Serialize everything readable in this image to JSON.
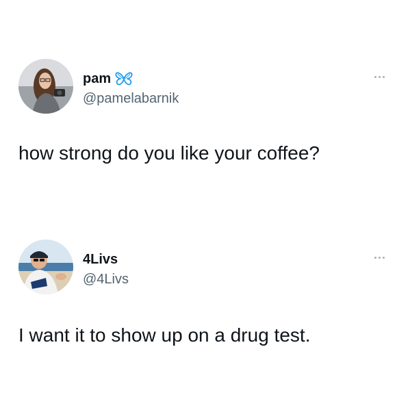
{
  "tweets": [
    {
      "display_name": "pam",
      "name_emoji": "butterfly-icon",
      "handle": "@pamelabarnik",
      "text": "how strong do you like your coffee?",
      "avatar": "profile-photo"
    },
    {
      "display_name": "4Livs",
      "handle": "@4Livs",
      "text": "I want it to show up on a drug test.",
      "avatar": "profile-photo"
    }
  ],
  "icons": {
    "more": "more-options-icon",
    "butterfly_color": "#1d9bf0"
  },
  "colors": {
    "text": "#0f1419",
    "secondary": "#536471",
    "background": "#ffffff"
  }
}
